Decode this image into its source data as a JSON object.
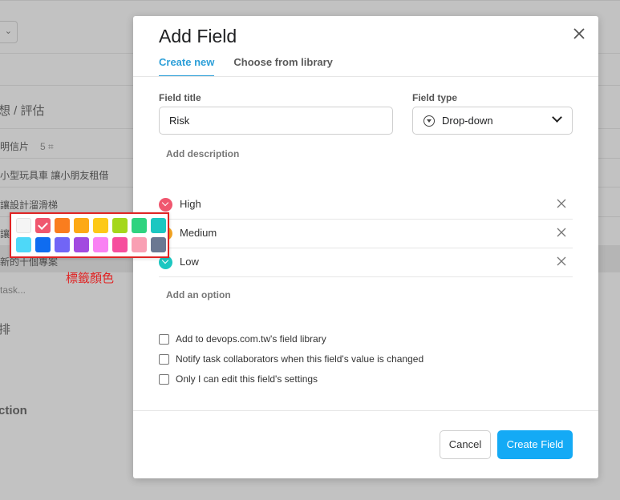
{
  "background": {
    "heading1": "想 / 評估",
    "items": [
      "明信片",
      "小型玩具車 讓小朋友租借",
      "讓設計溜滑梯",
      "新的十個專案"
    ],
    "item0_meta": "5 ⌗",
    "add_task": "task...",
    "heading2": "排",
    "heading3": "ction"
  },
  "modal": {
    "title": "Add Field",
    "tabs": [
      {
        "label": "Create new",
        "active": true
      },
      {
        "label": "Choose from library",
        "active": false
      }
    ],
    "field_title_label": "Field title",
    "field_title_value": "Risk",
    "field_type_label": "Field type",
    "field_type_value": "Drop-down",
    "add_description": "Add description",
    "options": [
      {
        "label": "High",
        "color": "#f0576f"
      },
      {
        "label": "Medium",
        "color": "#f5a623"
      },
      {
        "label": "Low",
        "color": "#1cc7c1"
      }
    ],
    "add_option": "Add an option",
    "checkboxes": [
      "Add to devops.com.tw's field library",
      "Notify task collaborators when this field's value is changed",
      "Only I can edit this field's settings"
    ],
    "cancel_label": "Cancel",
    "create_label": "Create Field"
  },
  "palette": {
    "caption": "標籤顏色",
    "selected_index": 1,
    "colors": [
      "#f5f5f5",
      "#f0576f",
      "#fa7d1e",
      "#fda915",
      "#fdc917",
      "#a4d71b",
      "#2fd37f",
      "#1cc7c1",
      "#4ed8f8",
      "#0f6cf0",
      "#7165f6",
      "#a24ae0",
      "#f982f3",
      "#f64e9d",
      "#f99fb3",
      "#6b7892"
    ]
  }
}
